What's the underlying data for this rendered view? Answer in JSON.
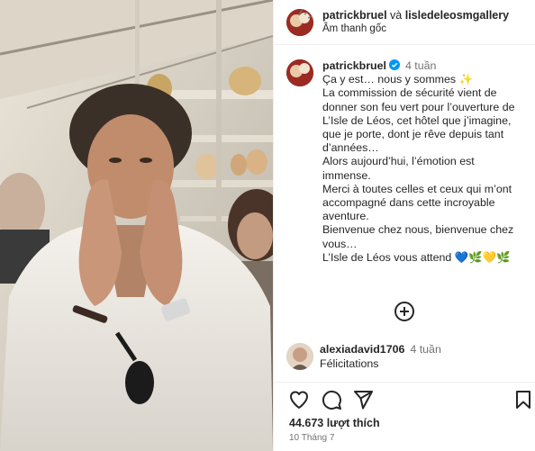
{
  "header": {
    "user1": "patrickbruel",
    "conjunction": " và ",
    "user2": "lisledeleosmgallery",
    "audio": "Âm thanh gốc"
  },
  "caption": {
    "username": "patrickbruel",
    "time": "4 tuần",
    "lines": [
      "Ça y est… nous y sommes ✨",
      "La commission de sécurité vient de",
      "donner son feu vert pour l’ouverture de",
      "L’Isle de Léos, cet hôtel que j’imagine,",
      "que je porte, dont je rêve depuis tant",
      "d’années…",
      "Alors aujourd’hui, l’émotion est",
      "immense.",
      "Merci à toutes celles et ceux qui m’ont",
      "accompagné dans cette incroyable",
      "aventure.",
      "Bienvenue chez nous, bienvenue chez",
      "vous…",
      "L’Isle de Léos vous attend 💙🌿💛🌿"
    ]
  },
  "comment": {
    "username": "alexiadavid1706",
    "time": "4 tuần",
    "text": "Félicitations"
  },
  "footer": {
    "likes": "44.673 lượt thích",
    "date": "10 Tháng 7"
  },
  "colors": {
    "text": "#262626",
    "secondary": "#737373",
    "verified": "#0095f6",
    "border": "#efefef"
  },
  "icons": [
    "more-options-icon",
    "verified-badge-icon",
    "load-more-comments-icon",
    "heart-icon",
    "comment-icon",
    "share-icon",
    "save-bookmark-icon"
  ]
}
